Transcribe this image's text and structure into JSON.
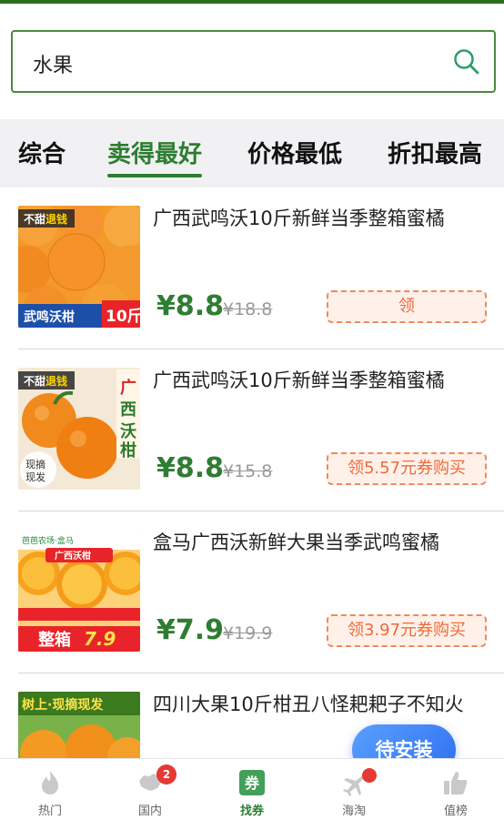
{
  "search": {
    "query": "水果"
  },
  "tabs": [
    {
      "label": "综合"
    },
    {
      "label": "卖得最好"
    },
    {
      "label": "价格最低"
    },
    {
      "label": "折扣最高"
    }
  ],
  "products": [
    {
      "title": "广西武鸣沃10斤新鲜当季整箱蜜橘",
      "price": "¥8.8",
      "original_price": "¥18.8",
      "coupon": "领",
      "image_text": [
        "不甜退钱",
        "武鸣沃柑",
        "10斤"
      ]
    },
    {
      "title": "广西武鸣沃10斤新鲜当季整箱蜜橘",
      "price": "¥8.8",
      "original_price": "¥15.8",
      "coupon": "领5.57元券购买",
      "image_text": [
        "不甜退钱",
        "广西沃柑",
        "现摘现发"
      ]
    },
    {
      "title": "盒马广西沃新鲜大果当季武鸣蜜橘",
      "price": "¥7.9",
      "original_price": "¥19.9",
      "coupon": "领3.97元券购买",
      "image_text": [
        "广西沃柑",
        "整箱",
        "7.9"
      ]
    },
    {
      "title": "四川大果10斤柑丑八怪耙耙子不知火",
      "image_text": [
        "树上·现摘现发"
      ]
    }
  ],
  "fab": {
    "label": "待安装"
  },
  "tabbar": [
    {
      "label": "热门",
      "icon": "flame-icon"
    },
    {
      "label": "国内",
      "icon": "china-map-icon",
      "badge": "2"
    },
    {
      "label": "找券",
      "icon": "coupon-icon"
    },
    {
      "label": "海淘",
      "icon": "airplane-icon",
      "badge": ""
    },
    {
      "label": "值榜",
      "icon": "thumbs-up-icon"
    }
  ],
  "colors": {
    "accent": "#2e7d32",
    "coupon_text": "#f06a3a",
    "fab": "#3d7ff5",
    "badge": "#e53935"
  }
}
